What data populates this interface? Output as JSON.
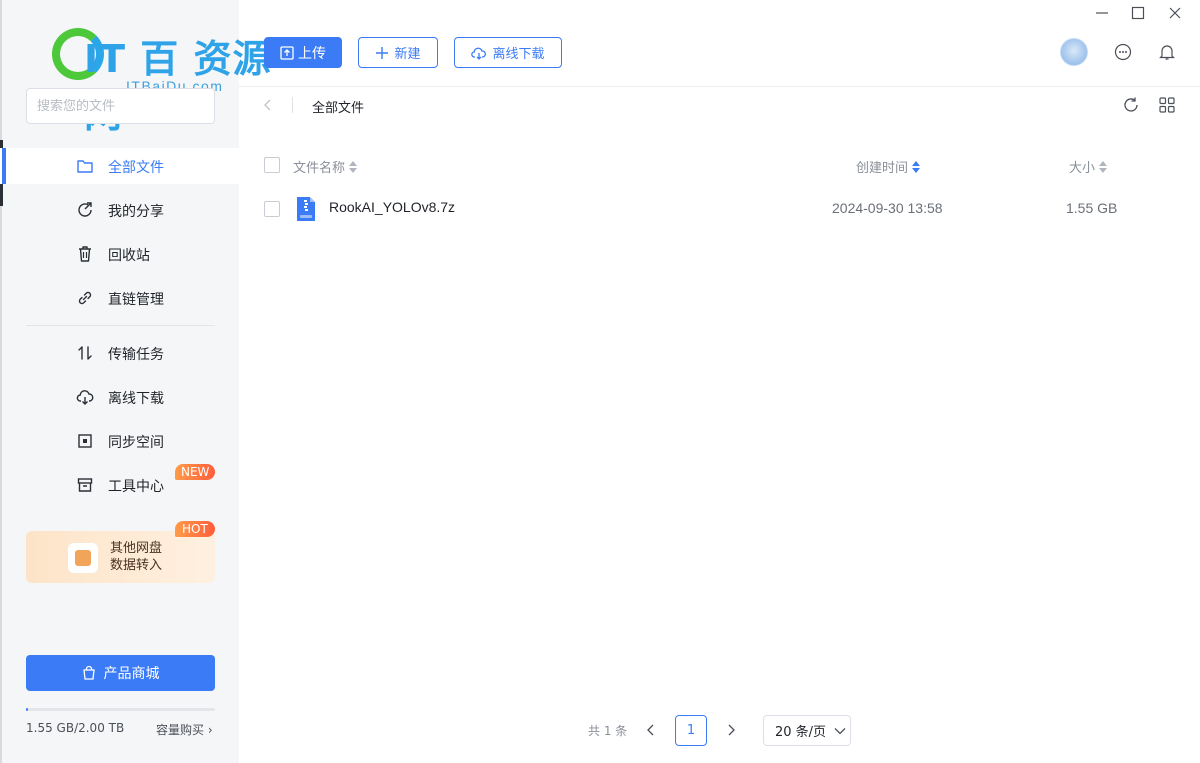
{
  "watermark": {
    "brand": "IT 百 资源网",
    "sub": "ITBaiDu.com"
  },
  "search": {
    "placeholder": "搜索您的文件"
  },
  "sidebar": {
    "items": [
      {
        "label": "全部文件",
        "icon": "folder-icon",
        "active": true
      },
      {
        "label": "我的分享",
        "icon": "share-icon"
      },
      {
        "label": "回收站",
        "icon": "trash-icon"
      },
      {
        "label": "直链管理",
        "icon": "link-icon"
      },
      {
        "label": "传输任务",
        "icon": "transfer-icon"
      },
      {
        "label": "离线下载",
        "icon": "cloud-download-icon"
      },
      {
        "label": "同步空间",
        "icon": "sync-icon"
      },
      {
        "label": "工具中心",
        "icon": "toolbox-icon",
        "badge": "NEW"
      }
    ],
    "promo": {
      "line1": "其他网盘",
      "line2": "数据转入",
      "badge": "HOT"
    },
    "shop_button": "产品商城",
    "quota": {
      "used_text": "1.55 GB/2.00 TB",
      "used_fraction": 0.00078,
      "buy_label": "容量购买"
    }
  },
  "toolbar": {
    "upload_label": "上传",
    "new_label": "新建",
    "offline_label": "离线下载"
  },
  "breadcrumb": {
    "current": "全部文件"
  },
  "table": {
    "headers": {
      "name": "文件名称",
      "created": "创建时间",
      "size": "大小"
    },
    "rows": [
      {
        "name": "RookAI_YOLOv8.7z",
        "created": "2024-09-30 13:58",
        "size": "1.55 GB"
      }
    ]
  },
  "pagination": {
    "total_text": "共 1 条",
    "current_page": "1",
    "page_size": "20 条/页"
  },
  "colors": {
    "accent": "#3b7cf6",
    "badge": "#ff6a3d"
  }
}
